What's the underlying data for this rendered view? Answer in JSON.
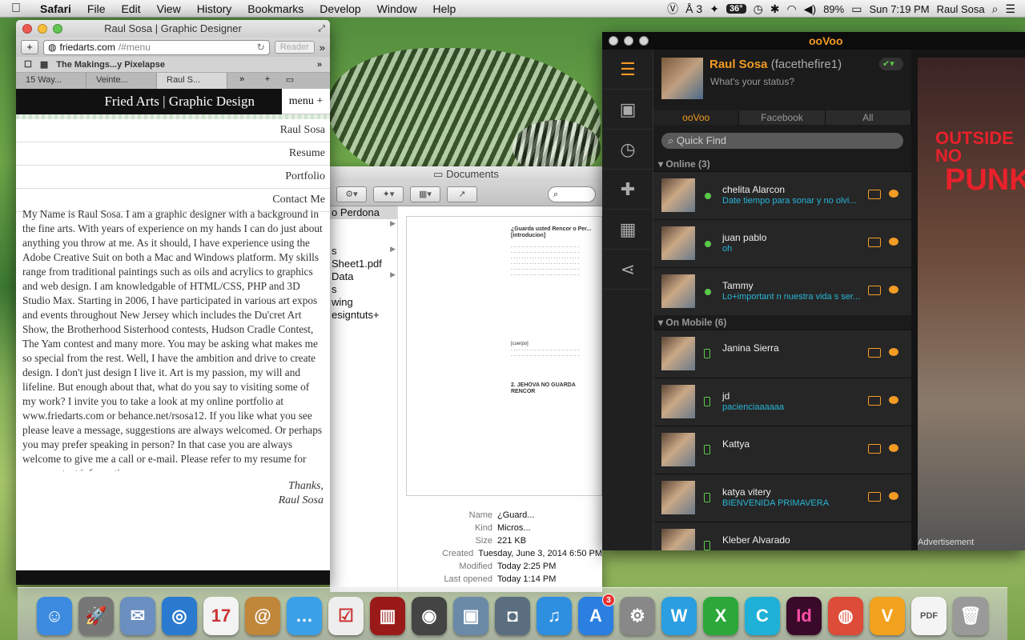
{
  "menubar": {
    "app": "Safari",
    "items": [
      "File",
      "Edit",
      "View",
      "History",
      "Bookmarks",
      "Develop",
      "Window",
      "Help"
    ],
    "adobe_count": "3",
    "temperature": "36°",
    "battery": "89%",
    "clock": "Sun 7:19 PM",
    "user": "Raul Sosa"
  },
  "safari": {
    "title": "Raul Sosa | Graphic Designer",
    "url_host": "friedarts.com",
    "url_path": "/#menu",
    "reader": "Reader",
    "bookmark": "The Makings...y Pixelapse",
    "tabs": [
      "15 Way...",
      "Veinte...",
      "Raul S..."
    ],
    "site_title": "Fried Arts | Graphic Design",
    "menu_label": "menu +",
    "nav": [
      "Raul Sosa",
      "Resume",
      "Portfolio",
      "Contact Me"
    ],
    "bio": "My Name is Raul Sosa. I am a graphic designer with a background in the fine arts. With years of experience on my hands I can do just about anything you throw at me. As it should, I have experience using the Adobe Creative Suit on both a Mac and Windows platform. My skills range from traditional paintings such as oils and acrylics to graphics and web design. I am knowledgable of HTML/CSS, PHP and 3D Studio Max. Starting in 2006, I have participated in various art expos and events throughout New Jersey which includes the Du'cret Art Show, the Brotherhood Sisterhood contests, Hudson Cradle Contest, The Yam contest and many more. You may be asking what makes me so special from the rest. Well, I have the ambition and drive to create design. I don't just design I live it. Art is my passion, my will and lifeline. But enough about that, what do you say to visiting some of my work? I invite you to take a look at my online portfolio at www.friedarts.com or behance.net/rsosa12. If you like what you see please leave a message, suggestions are always welcomed. Or perhaps you may prefer speaking in person? In that case you are always welcome to give me a call or e-mail. Please refer to my resume for more contact information.",
    "thanks": "Thanks,",
    "signature": "Raul Sosa"
  },
  "finder": {
    "title": "Documents",
    "files": [
      "o Perdona",
      "",
      "",
      "s",
      "Sheet1.pdf",
      "Data",
      "s",
      "wing",
      "esigntuts+"
    ],
    "doc_heading": "¿Guarda usted Rencor o Per... [introducion]",
    "doc_section": "[cuerpo]",
    "doc_point": "2. JEHOVA NO GUARDA RENCOR",
    "info": [
      {
        "k": "Name",
        "v": "¿Guard..."
      },
      {
        "k": "Kind",
        "v": "Micros..."
      },
      {
        "k": "Size",
        "v": "221 KB"
      },
      {
        "k": "Created",
        "v": "Tuesday, June 3, 2014 6:50 PM"
      },
      {
        "k": "Modified",
        "v": "Today 2:25 PM"
      },
      {
        "k": "Last opened",
        "v": "Today 1:14 PM"
      }
    ]
  },
  "oovoo": {
    "logo": "ooVoo",
    "user_name": "Raul Sosa",
    "user_handle": "(facethefire1)",
    "status_placeholder": "What's your status?",
    "tabs": [
      "ooVoo",
      "Facebook",
      "All"
    ],
    "quick_find": "Quick Find",
    "online_header": "Online (3)",
    "mobile_header": "On Mobile (6)",
    "online": [
      {
        "name": "chelita Alarcon",
        "status": "Date tiempo para sonar y no olvi..."
      },
      {
        "name": "juan pablo",
        "status": "oh"
      },
      {
        "name": "Tammy",
        "status": "Lo+important n nuestra vida s ser..."
      }
    ],
    "mobile": [
      {
        "name": "Janina Sierra",
        "status": ""
      },
      {
        "name": "jd",
        "status": "pacienciaaaaaa"
      },
      {
        "name": "Kattya",
        "status": ""
      },
      {
        "name": "katya vitery",
        "status": "BIENVENIDA PRIMAVERA"
      },
      {
        "name": "Kleber Alvarado",
        "status": ""
      }
    ],
    "ad_line1": "OUTSIDE NO",
    "ad_line2": "PUNK",
    "ad_label": "Advertisement"
  },
  "dock": {
    "app_store_badge": "3",
    "calendar_day": "17",
    "items": [
      {
        "name": "finder-dock-icon",
        "glyph": "☺",
        "color": "#3d8be0"
      },
      {
        "name": "launchpad-dock-icon",
        "glyph": "🚀",
        "color": "#777"
      },
      {
        "name": "mail-dock-icon",
        "glyph": "✉",
        "color": "#6a8fc0"
      },
      {
        "name": "safari-dock-icon",
        "glyph": "◎",
        "color": "#2a7ad0"
      },
      {
        "name": "calendar-dock-icon",
        "glyph": "17",
        "color": "#f3f3f3"
      },
      {
        "name": "contacts-dock-icon",
        "glyph": "@",
        "color": "#c0863a"
      },
      {
        "name": "messages-dock-icon",
        "glyph": "…",
        "color": "#3aa0e8"
      },
      {
        "name": "reminders-dock-icon",
        "glyph": "☑",
        "color": "#eeeeee"
      },
      {
        "name": "photo-booth-dock-icon",
        "glyph": "▥",
        "color": "#9a1a1a"
      },
      {
        "name": "facetime-dock-icon",
        "glyph": "◉",
        "color": "#444"
      },
      {
        "name": "iphoto-dock-icon",
        "glyph": "▣",
        "color": "#6b8aa8"
      },
      {
        "name": "image-capture-dock-icon",
        "glyph": "◘",
        "color": "#5a6e80"
      },
      {
        "name": "itunes-dock-icon",
        "glyph": "♫",
        "color": "#2e8ee0"
      },
      {
        "name": "app-store-dock-icon",
        "glyph": "A",
        "color": "#2a7fe0"
      },
      {
        "name": "system-preferences-dock-icon",
        "glyph": "⚙",
        "color": "#888"
      },
      {
        "name": "word-dock-icon",
        "glyph": "W",
        "color": "#2a9ee0"
      },
      {
        "name": "excel-dock-icon",
        "glyph": "X",
        "color": "#2ca83a"
      },
      {
        "name": "c-app-dock-icon",
        "glyph": "C",
        "color": "#1fb0d8"
      },
      {
        "name": "indesign-dock-icon",
        "glyph": "Id",
        "color": "#3a0a2a"
      },
      {
        "name": "chrome-dock-icon",
        "glyph": "◍",
        "color": "#dd4b39"
      },
      {
        "name": "oovoo-dock-icon",
        "glyph": "V",
        "color": "#f2a21e"
      },
      {
        "name": "pdf-document-dock-icon",
        "glyph": "PDF",
        "color": "#f4f4f4"
      },
      {
        "name": "trash-dock-icon",
        "glyph": "🗑",
        "color": "#9a9a9a"
      }
    ]
  }
}
